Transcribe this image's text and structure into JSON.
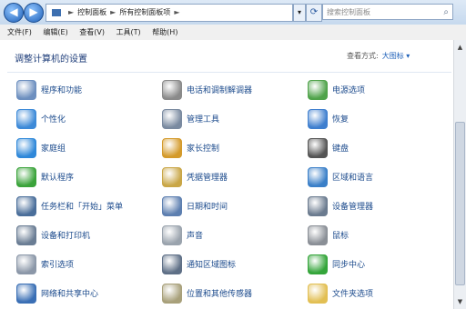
{
  "address": {
    "crumbs": [
      "控制面板",
      "所有控制面板项"
    ],
    "separator": "►"
  },
  "search": {
    "placeholder": "搜索控制面板"
  },
  "menu": [
    "文件(F)",
    "编辑(E)",
    "查看(V)",
    "工具(T)",
    "帮助(H)"
  ],
  "content": {
    "heading": "调整计算机的设置",
    "view_by_label": "查看方式:",
    "view_by_value": "大图标 ▾"
  },
  "items": [
    {
      "label": "程序和功能",
      "icon": "programs-icon",
      "color": "#6d8fbf"
    },
    {
      "label": "电话和调制解调器",
      "icon": "phone-modem-icon",
      "color": "#8a8a8a"
    },
    {
      "label": "电源选项",
      "icon": "power-options-icon",
      "color": "#4fa34a"
    },
    {
      "label": "个性化",
      "icon": "personalization-icon",
      "color": "#3d8ad8"
    },
    {
      "label": "管理工具",
      "icon": "admin-tools-icon",
      "color": "#7a8aa0"
    },
    {
      "label": "恢复",
      "icon": "recovery-icon",
      "color": "#3f7fcf"
    },
    {
      "label": "家庭组",
      "icon": "homegroup-icon",
      "color": "#2f88d9"
    },
    {
      "label": "家长控制",
      "icon": "parental-controls-icon",
      "color": "#d49a2b"
    },
    {
      "label": "键盘",
      "icon": "keyboard-icon",
      "color": "#555555"
    },
    {
      "label": "默认程序",
      "icon": "default-programs-icon",
      "color": "#3aa33a"
    },
    {
      "label": "凭据管理器",
      "icon": "credential-manager-icon",
      "color": "#c9a646"
    },
    {
      "label": "区域和语言",
      "icon": "region-language-icon",
      "color": "#3a7fc8"
    },
    {
      "label": "任务栏和「开始」菜单",
      "icon": "taskbar-icon",
      "color": "#4a6e9a"
    },
    {
      "label": "日期和时间",
      "icon": "date-time-icon",
      "color": "#5d7fb0"
    },
    {
      "label": "设备管理器",
      "icon": "device-manager-icon",
      "color": "#6b7b8f"
    },
    {
      "label": "设备和打印机",
      "icon": "devices-printers-icon",
      "color": "#6a7d94"
    },
    {
      "label": "声音",
      "icon": "sound-icon",
      "color": "#9aa3ad"
    },
    {
      "label": "鼠标",
      "icon": "mouse-icon",
      "color": "#8a8f96"
    },
    {
      "label": "索引选项",
      "icon": "indexing-icon",
      "color": "#8b97a8"
    },
    {
      "label": "通知区域图标",
      "icon": "notification-area-icon",
      "color": "#5e6f86"
    },
    {
      "label": "同步中心",
      "icon": "sync-center-icon",
      "color": "#34a53a"
    },
    {
      "label": "网络和共享中心",
      "icon": "network-sharing-icon",
      "color": "#3a6fb5"
    },
    {
      "label": "位置和其他传感器",
      "icon": "location-sensors-icon",
      "color": "#a8a07a"
    },
    {
      "label": "文件夹选项",
      "icon": "folder-options-icon",
      "color": "#e2bf53"
    }
  ]
}
